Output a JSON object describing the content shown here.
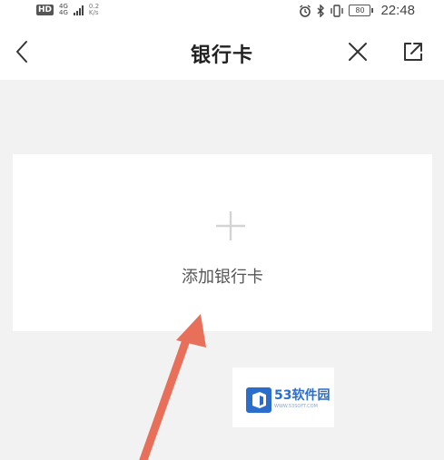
{
  "status_bar": {
    "hd": "HD",
    "network_top": "4G",
    "network_bottom": "4G",
    "speed_top": "0.2",
    "speed_bottom": "K/s",
    "battery": "80",
    "time": "22:48",
    "icons": [
      "alarm-icon",
      "bluetooth-icon",
      "vibrate-icon",
      "battery-icon"
    ]
  },
  "nav": {
    "title": "银行卡",
    "back_icon": "chevron-left-icon",
    "close_icon": "close-icon",
    "share_icon": "share-icon"
  },
  "add_card": {
    "label": "添加银行卡",
    "icon": "plus-icon"
  },
  "watermark": {
    "brand": "53软件园",
    "url": "WWW.53SOFT.COM"
  },
  "colors": {
    "background": "#f2f2f2",
    "panel": "#ffffff",
    "annotation_arrow": "#e8705a",
    "watermark_blue": "#2b6dcc"
  }
}
